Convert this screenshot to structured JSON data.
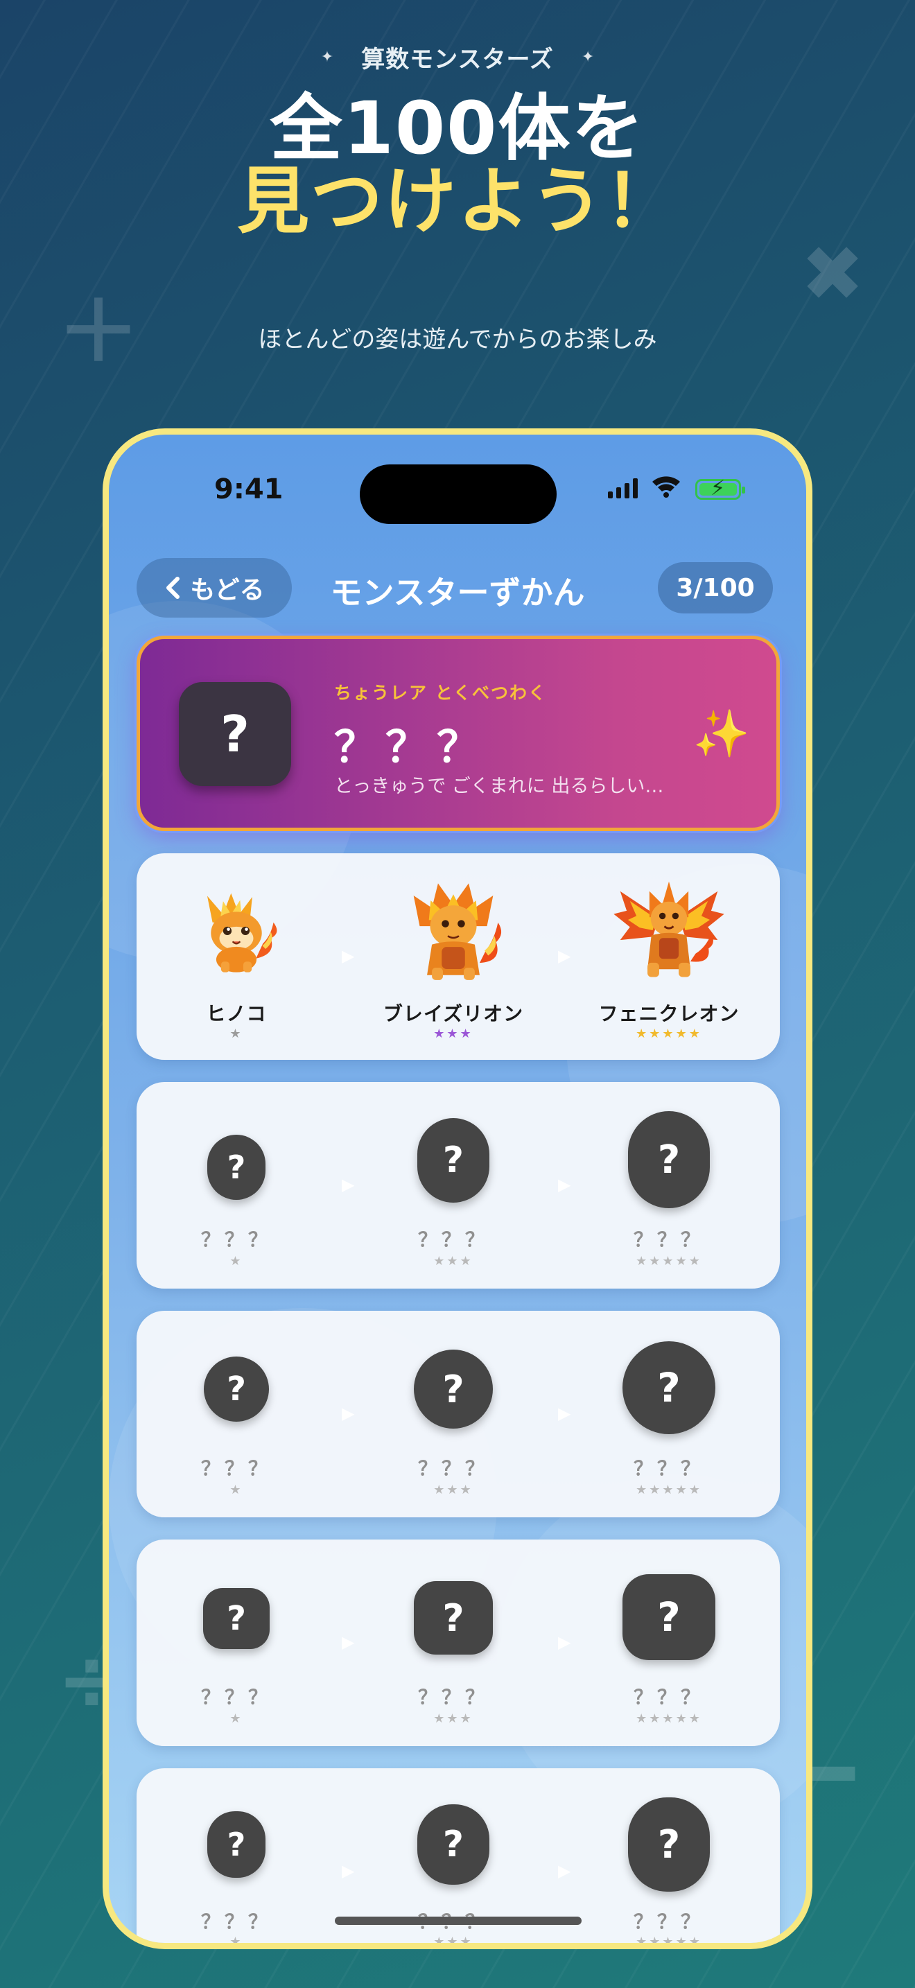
{
  "app_name": "算数モンスターズ",
  "headline": {
    "line1": "全100体を",
    "line2": "見つけよう！"
  },
  "subline": "ほとんどの姿は遊んでからのお楽しみ",
  "decorations": {
    "plus": "＋",
    "times": "✖",
    "divide": "÷",
    "minus": "━",
    "sparkle": "✦"
  },
  "status_bar": {
    "time": "9:41"
  },
  "nav": {
    "back_label": "もどる",
    "title": "モンスターずかん",
    "count": "3/100"
  },
  "special_card": {
    "icon_text": "?",
    "label": "ちょうレア とくべつわく",
    "name": "？？？",
    "description": "とっきゅうで ごくまれに 出るらしい…",
    "sparkle": "✨"
  },
  "rows": [
    {
      "cells": [
        {
          "name": "ヒノコ",
          "stars": "★"
        },
        {
          "name": "ブレイズリオン",
          "stars": "★★★"
        },
        {
          "name": "フェニクレオン",
          "stars": "★★★★★"
        }
      ]
    },
    {
      "cells": [
        {
          "name": "？？？",
          "stars": "★",
          "icon_text": "?"
        },
        {
          "name": "？？？",
          "stars": "★★★",
          "icon_text": "?"
        },
        {
          "name": "？？？",
          "stars": "★★★★★",
          "icon_text": "?"
        }
      ]
    },
    {
      "cells": [
        {
          "name": "？？？",
          "stars": "★",
          "icon_text": "?"
        },
        {
          "name": "？？？",
          "stars": "★★★",
          "icon_text": "?"
        },
        {
          "name": "？？？",
          "stars": "★★★★★",
          "icon_text": "?"
        }
      ]
    },
    {
      "cells": [
        {
          "name": "？？？",
          "stars": "★",
          "icon_text": "?"
        },
        {
          "name": "？？？",
          "stars": "★★★",
          "icon_text": "?"
        },
        {
          "name": "？？？",
          "stars": "★★★★★",
          "icon_text": "?"
        }
      ]
    },
    {
      "cells": [
        {
          "name": "？？？",
          "stars": "★",
          "icon_text": "?"
        },
        {
          "name": "？？？",
          "stars": "★★★",
          "icon_text": "?"
        },
        {
          "name": "？？？",
          "stars": "★★★★★",
          "icon_text": "?"
        }
      ]
    }
  ],
  "colors": {
    "accent_yellow": "#fde26a",
    "rare_purple": "#9a55d6",
    "legend_gold": "#f1b92b",
    "phone_frame": "#f7e880"
  }
}
